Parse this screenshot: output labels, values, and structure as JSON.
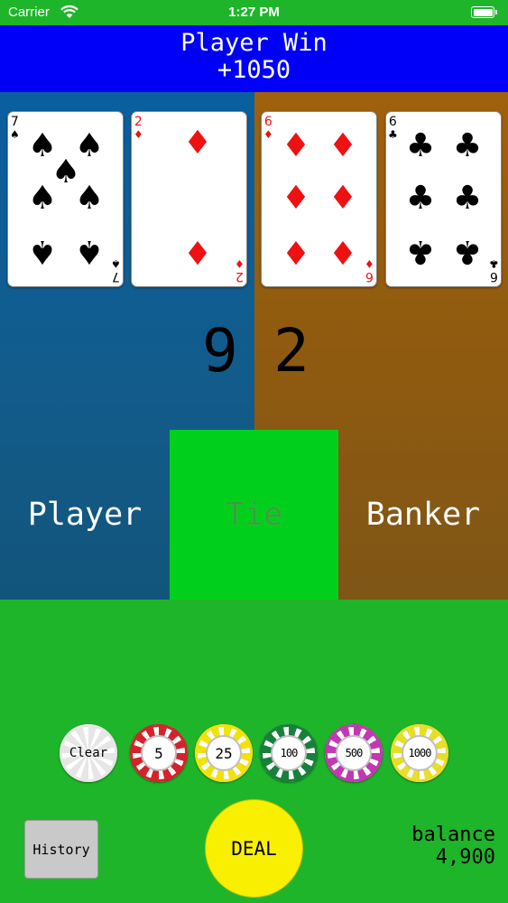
{
  "status_bar": {
    "carrier": "Carrier",
    "time": "1:27 PM"
  },
  "result": {
    "title": "Player Win",
    "amount": "+1050"
  },
  "cards": [
    {
      "rank": "7",
      "suit": "♠",
      "color": "black"
    },
    {
      "rank": "2",
      "suit": "♦",
      "color": "red"
    },
    {
      "rank": "6",
      "suit": "♦",
      "color": "red"
    },
    {
      "rank": "6",
      "suit": "♣",
      "color": "black"
    }
  ],
  "scores": {
    "player": "9",
    "banker": "2"
  },
  "bets": {
    "player": "Player",
    "tie": "Tie",
    "banker": "Banker"
  },
  "chips": [
    {
      "label": "Clear",
      "color": "#e6e6e6"
    },
    {
      "label": "5",
      "color": "#d4232c"
    },
    {
      "label": "25",
      "color": "#f2e20a"
    },
    {
      "label": "100",
      "color": "#17803a"
    },
    {
      "label": "500",
      "color": "#c238b4"
    },
    {
      "label": "1000",
      "color": "#e8de26"
    }
  ],
  "controls": {
    "history": "History",
    "deal": "DEAL",
    "balance_label": "balance",
    "balance_value": "4,900"
  },
  "colors": {
    "banner": "#0000f8",
    "player_side": "#0a5f9e",
    "banker_side": "#a0610c",
    "felt": "#1fb52a",
    "tie_highlight": "#00d01c"
  }
}
